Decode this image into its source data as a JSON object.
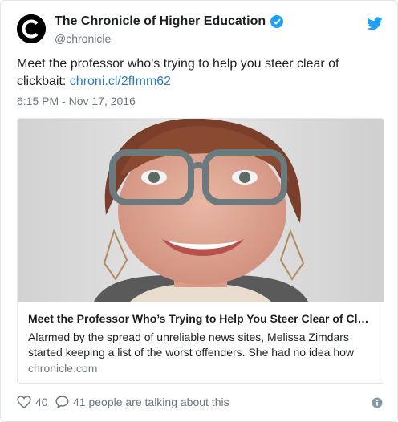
{
  "account": {
    "name": "The Chronicle of Higher Education",
    "handle": "@chronicle",
    "verified": true
  },
  "tweet": {
    "text": "Meet the professor who's trying to help you steer clear of clickbait: ",
    "link": "chroni.cl/2fImm62",
    "timestamp": "6:15 PM - Nov 17, 2016"
  },
  "card": {
    "title": "Meet the Professor Who’s Trying to Help You Steer Clear of Cl…",
    "description": "Alarmed by the spread of unreliable news sites, Melissa Zimdars started keeping a list of the worst offenders. She had no idea how",
    "domain": "chronicle.com"
  },
  "footer": {
    "likes": "40",
    "talking": "41 people are talking about this"
  },
  "colors": {
    "link": "#2b7bb9",
    "twitter_blue": "#1da1f2",
    "muted": "#697882",
    "border": "#e1e8ed"
  },
  "icons": [
    "chronicle-logo-icon",
    "verified-badge-icon",
    "twitter-bird-icon",
    "heart-icon",
    "speech-bubble-icon",
    "info-icon"
  ]
}
